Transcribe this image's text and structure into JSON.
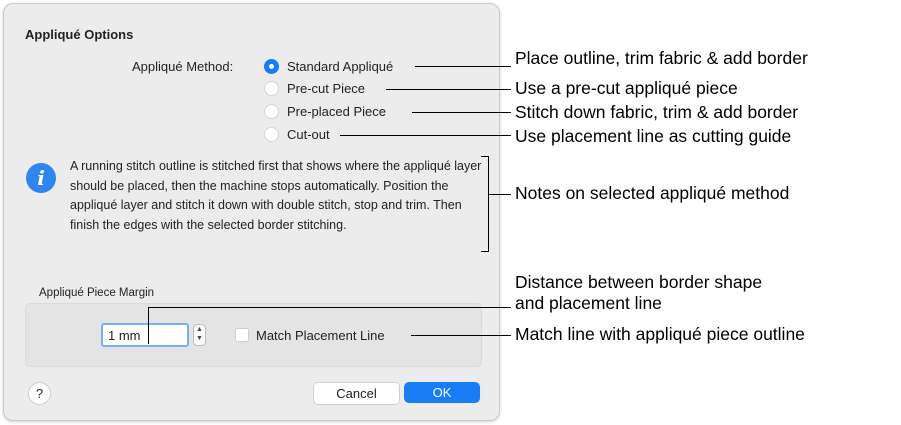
{
  "dialog": {
    "title": "Appliqué Options",
    "method_label": "Appliqué Method:",
    "methods": [
      {
        "label": "Standard Appliqué",
        "selected": true
      },
      {
        "label": "Pre-cut Piece",
        "selected": false
      },
      {
        "label": "Pre-placed Piece",
        "selected": false
      },
      {
        "label": "Cut-out",
        "selected": false
      }
    ],
    "info_icon": "info-icon",
    "notes": "A running stitch outline is stitched first that shows where the appliqué layer should be placed, then the machine stops automatically. Position the appliqué layer and stitch it down with double stitch, stop and trim. Then finish the edges with the selected border stitching.",
    "margin": {
      "label": "Appliqué Piece Margin",
      "value": "1 mm",
      "stepper_icon": "stepper-arrows-icon",
      "match_label": "Match Placement Line",
      "match_checked": false
    },
    "help": "?",
    "cancel": "Cancel",
    "ok": "OK",
    "accent": "#1a7cf5"
  },
  "callouts": {
    "standard": "Place outline, trim fabric & add border",
    "precut": "Use a pre-cut appliqué piece",
    "preplaced": "Stitch down fabric, trim & add border",
    "cutout": "Use placement line as cutting guide",
    "notes": "Notes on selected appliqué method",
    "distance_line1": "Distance between border shape",
    "distance_line2": "and placement line",
    "match": "Match line with appliqué piece outline"
  }
}
